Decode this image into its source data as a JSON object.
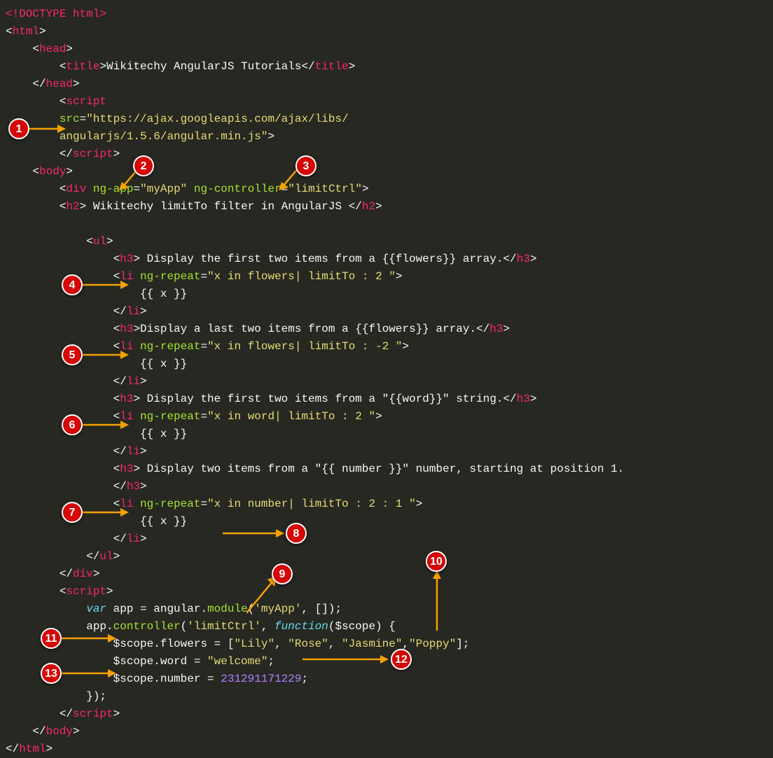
{
  "code_lines": [
    [
      [
        "tag",
        "<!DOCTYPE html>"
      ]
    ],
    [
      [
        "pun",
        "<"
      ],
      [
        "tag",
        "html"
      ],
      [
        "pun",
        ">"
      ]
    ],
    [
      [
        "pun",
        "    <"
      ],
      [
        "tag",
        "head"
      ],
      [
        "pun",
        ">"
      ]
    ],
    [
      [
        "pun",
        "        <"
      ],
      [
        "tag",
        "title"
      ],
      [
        "pun",
        ">Wikitechy AngularJS Tutorials</"
      ],
      [
        "tag",
        "title"
      ],
      [
        "pun",
        ">"
      ]
    ],
    [
      [
        "pun",
        "    </"
      ],
      [
        "tag",
        "head"
      ],
      [
        "pun",
        ">"
      ]
    ],
    [
      [
        "pun",
        "        <"
      ],
      [
        "tag",
        "script"
      ]
    ],
    [
      [
        "pun",
        "        "
      ],
      [
        "attr",
        "src"
      ],
      [
        "pun",
        "="
      ],
      [
        "str",
        "\"https://ajax.googleapis.com/ajax/libs/"
      ]
    ],
    [
      [
        "pun",
        "        "
      ],
      [
        "str",
        "angularjs/1.5.6/angular.min.js\""
      ],
      [
        "pun",
        ">"
      ]
    ],
    [
      [
        "pun",
        "        </"
      ],
      [
        "tag",
        "script"
      ],
      [
        "pun",
        ">"
      ]
    ],
    [
      [
        "pun",
        "    <"
      ],
      [
        "tag",
        "body"
      ],
      [
        "pun",
        ">"
      ]
    ],
    [
      [
        "pun",
        "        <"
      ],
      [
        "tag",
        "div"
      ],
      [
        "pun",
        " "
      ],
      [
        "attr",
        "ng-app"
      ],
      [
        "pun",
        "="
      ],
      [
        "str",
        "\"myApp\""
      ],
      [
        "pun",
        " "
      ],
      [
        "attr",
        "ng-controller"
      ],
      [
        "pun",
        "="
      ],
      [
        "str",
        "\"limitCtrl\""
      ],
      [
        "pun",
        ">"
      ]
    ],
    [
      [
        "pun",
        "        <"
      ],
      [
        "tag",
        "h2"
      ],
      [
        "pun",
        "> Wikitechy limitTo filter in AngularJS </"
      ],
      [
        "tag",
        "h2"
      ],
      [
        "pun",
        ">"
      ]
    ],
    [
      [
        "pun",
        ""
      ]
    ],
    [
      [
        "pun",
        "            <"
      ],
      [
        "tag",
        "ul"
      ],
      [
        "pun",
        ">"
      ]
    ],
    [
      [
        "pun",
        "                <"
      ],
      [
        "tag",
        "h3"
      ],
      [
        "pun",
        "> Display the first two items from a {{flowers}} array.</"
      ],
      [
        "tag",
        "h3"
      ],
      [
        "pun",
        ">"
      ]
    ],
    [
      [
        "pun",
        "                <"
      ],
      [
        "tag",
        "li"
      ],
      [
        "pun",
        " "
      ],
      [
        "attr",
        "ng-repeat"
      ],
      [
        "pun",
        "="
      ],
      [
        "str",
        "\"x in flowers| limitTo : 2 \""
      ],
      [
        "pun",
        ">"
      ]
    ],
    [
      [
        "pun",
        "                    {{ x }}"
      ]
    ],
    [
      [
        "pun",
        "                </"
      ],
      [
        "tag",
        "li"
      ],
      [
        "pun",
        ">"
      ]
    ],
    [
      [
        "pun",
        "                <"
      ],
      [
        "tag",
        "h3"
      ],
      [
        "pun",
        ">Display a last two items from a {{flowers}} array.</"
      ],
      [
        "tag",
        "h3"
      ],
      [
        "pun",
        ">"
      ]
    ],
    [
      [
        "pun",
        "                <"
      ],
      [
        "tag",
        "li"
      ],
      [
        "pun",
        " "
      ],
      [
        "attr",
        "ng-repeat"
      ],
      [
        "pun",
        "="
      ],
      [
        "str",
        "\"x in flowers| limitTo : -2 \""
      ],
      [
        "pun",
        ">"
      ]
    ],
    [
      [
        "pun",
        "                    {{ x }}"
      ]
    ],
    [
      [
        "pun",
        "                </"
      ],
      [
        "tag",
        "li"
      ],
      [
        "pun",
        ">"
      ]
    ],
    [
      [
        "pun",
        "                <"
      ],
      [
        "tag",
        "h3"
      ],
      [
        "pun",
        "> Display the first two items from a \"{{word}}\" string.</"
      ],
      [
        "tag",
        "h3"
      ],
      [
        "pun",
        ">"
      ]
    ],
    [
      [
        "pun",
        "                <"
      ],
      [
        "tag",
        "li"
      ],
      [
        "pun",
        " "
      ],
      [
        "attr",
        "ng-repeat"
      ],
      [
        "pun",
        "="
      ],
      [
        "str",
        "\"x in word| limitTo : 2 \""
      ],
      [
        "pun",
        ">"
      ]
    ],
    [
      [
        "pun",
        "                    {{ x }}"
      ]
    ],
    [
      [
        "pun",
        "                </"
      ],
      [
        "tag",
        "li"
      ],
      [
        "pun",
        ">"
      ]
    ],
    [
      [
        "pun",
        "                <"
      ],
      [
        "tag",
        "h3"
      ],
      [
        "pun",
        "> Display two items from a \"{{ number }}\" number, starting at position 1."
      ]
    ],
    [
      [
        "pun",
        "                </"
      ],
      [
        "tag",
        "h3"
      ],
      [
        "pun",
        ">"
      ]
    ],
    [
      [
        "pun",
        "                <"
      ],
      [
        "tag",
        "li"
      ],
      [
        "pun",
        " "
      ],
      [
        "attr",
        "ng-repeat"
      ],
      [
        "pun",
        "="
      ],
      [
        "str",
        "\"x in number| limitTo : 2 : 1 \""
      ],
      [
        "pun",
        ">"
      ]
    ],
    [
      [
        "pun",
        "                    {{ x }}"
      ]
    ],
    [
      [
        "pun",
        "                </"
      ],
      [
        "tag",
        "li"
      ],
      [
        "pun",
        ">"
      ]
    ],
    [
      [
        "pun",
        "            </"
      ],
      [
        "tag",
        "ul"
      ],
      [
        "pun",
        ">"
      ]
    ],
    [
      [
        "pun",
        "        </"
      ],
      [
        "tag",
        "div"
      ],
      [
        "pun",
        ">"
      ]
    ],
    [
      [
        "pun",
        "        <"
      ],
      [
        "tag",
        "script"
      ],
      [
        "pun",
        ">"
      ]
    ],
    [
      [
        "pun",
        "            "
      ],
      [
        "kw",
        "var"
      ],
      [
        "pun",
        " app = angular."
      ],
      [
        "fn",
        "module"
      ],
      [
        "pun",
        "("
      ],
      [
        "str",
        "'myApp'"
      ],
      [
        "pun",
        ", []);"
      ]
    ],
    [
      [
        "pun",
        "            app."
      ],
      [
        "fn",
        "controller"
      ],
      [
        "pun",
        "("
      ],
      [
        "str",
        "'limitCtrl'"
      ],
      [
        "pun",
        ", "
      ],
      [
        "var",
        "function"
      ],
      [
        "pun",
        "($scope) {"
      ]
    ],
    [
      [
        "pun",
        "                $scope.flowers = ["
      ],
      [
        "str",
        "\"Lily\""
      ],
      [
        "pun",
        ", "
      ],
      [
        "str",
        "\"Rose\""
      ],
      [
        "pun",
        ", "
      ],
      [
        "str",
        "\"Jasmine\""
      ],
      [
        "pun",
        ","
      ],
      [
        "str",
        "\"Poppy\""
      ],
      [
        "pun",
        "];"
      ]
    ],
    [
      [
        "pun",
        "                $scope.word = "
      ],
      [
        "str",
        "\"welcome\""
      ],
      [
        "pun",
        ";"
      ]
    ],
    [
      [
        "pun",
        "                $scope.number = "
      ],
      [
        "num",
        "231291171229"
      ],
      [
        "pun",
        ";"
      ]
    ],
    [
      [
        "pun",
        "            });"
      ]
    ],
    [
      [
        "pun",
        "        </"
      ],
      [
        "tag",
        "script"
      ],
      [
        "pun",
        ">"
      ]
    ],
    [
      [
        "pun",
        "    </"
      ],
      [
        "tag",
        "body"
      ],
      [
        "pun",
        ">"
      ]
    ],
    [
      [
        "pun",
        "</"
      ],
      [
        "tag",
        "html"
      ],
      [
        "pun",
        ">"
      ]
    ]
  ],
  "markers": {
    "1": "1",
    "2": "2",
    "3": "3",
    "4": "4",
    "5": "5",
    "6": "6",
    "7": "7",
    "8": "8",
    "9": "9",
    "10": "10",
    "11": "11",
    "12": "12",
    "13": "13"
  }
}
